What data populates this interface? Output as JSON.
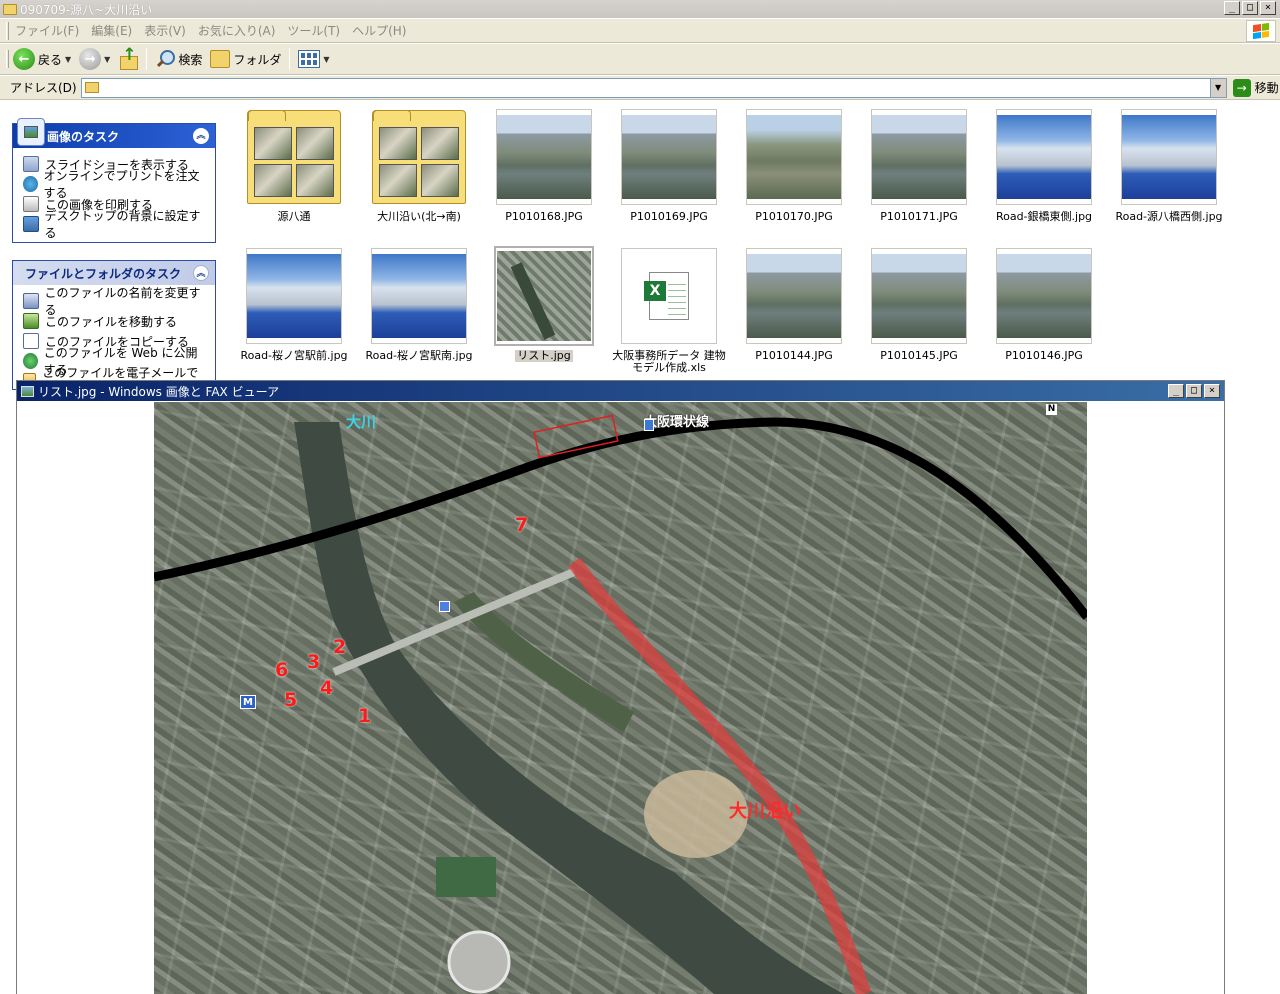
{
  "explorer": {
    "title": "090709-源八~大川沿い",
    "menu": [
      "ファイル(F)",
      "編集(E)",
      "表示(V)",
      "お気に入り(A)",
      "ツール(T)",
      "ヘルプ(H)"
    ],
    "toolbar": {
      "back_label": "戻る",
      "search_label": "検索",
      "folders_label": "フォルダ"
    },
    "address": {
      "label": "アドレス(D)",
      "value": "",
      "go_label": "移動"
    }
  },
  "task_panes": {
    "picture_tasks": {
      "title": "画像のタスク",
      "items": [
        "スライドショーを表示する",
        "オンラインでプリントを注文する",
        "この画像を印刷する",
        "デスクトップの背景に設定する"
      ]
    },
    "file_tasks": {
      "title": "ファイルとフォルダのタスク",
      "items": [
        "このファイルの名前を変更する",
        "このファイルを移動する",
        "このファイルをコピーする",
        "このファイルを Web に公開する",
        "このファイルを電子メールで送信する"
      ]
    }
  },
  "files": [
    {
      "name": "源八通",
      "kind": "folder"
    },
    {
      "name": "大川沿い(北→南)",
      "kind": "folder"
    },
    {
      "name": "P1010168.JPG",
      "kind": "photo-river"
    },
    {
      "name": "P1010169.JPG",
      "kind": "photo-river"
    },
    {
      "name": "P1010170.JPG",
      "kind": "photo-park"
    },
    {
      "name": "P1010171.JPG",
      "kind": "photo-river"
    },
    {
      "name": "Road-銀橋東側.jpg",
      "kind": "photo-model"
    },
    {
      "name": "Road-源八橋西側.jpg",
      "kind": "photo-model"
    },
    {
      "name": "Road-桜ノ宮駅前.jpg",
      "kind": "photo-model"
    },
    {
      "name": "Road-桜ノ宮駅南.jpg",
      "kind": "photo-model"
    },
    {
      "name": "リスト.jpg",
      "kind": "photo-map",
      "selected": true
    },
    {
      "name": "大阪事務所データ 建物モデル作成.xls",
      "kind": "xls"
    },
    {
      "name": "P1010144.JPG",
      "kind": "photo-river"
    },
    {
      "name": "P1010145.JPG",
      "kind": "photo-river"
    },
    {
      "name": "P1010146.JPG",
      "kind": "photo-river"
    }
  ],
  "viewer": {
    "title": "リスト.jpg - Windows 画像と FAX ビューア",
    "map": {
      "river_label": "大川",
      "rail_label": "大阪環状線",
      "route_label": "大川沿い",
      "north_label": "N",
      "metro_label": "M",
      "markers": [
        "1",
        "2",
        "3",
        "4",
        "5",
        "6",
        "7"
      ]
    }
  },
  "window_controls": {
    "minimize": "_",
    "maximize": "□",
    "close": "×"
  }
}
